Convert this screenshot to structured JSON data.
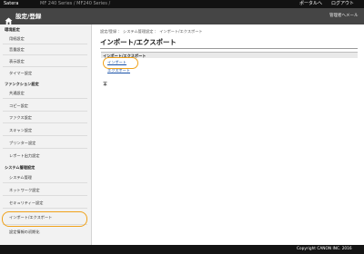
{
  "topbar": {
    "brand": "Satera",
    "device": "MF 240 Series / MF240 Series / ",
    "portal": "ポータルへ",
    "logout": "ログアウト"
  },
  "header": {
    "title": "設定/登録",
    "mail_admin": "管理者へメール"
  },
  "sidebar": {
    "sec_preferences": "環境設定",
    "items_preferences": [
      "用紙設定",
      "音量設定",
      "表示設定",
      "タイマー設定"
    ],
    "sec_function": "ファンクション設定",
    "items_function": [
      "共通設定",
      "コピー設定",
      "ファクス設定",
      "スキャン設定",
      "プリンター設定",
      "レポート出力設定"
    ],
    "sec_system": "システム管理設定",
    "items_system": [
      "システム管理",
      "ネットワーク設定",
      "セキュリティー設定",
      "インポート/エクスポート",
      "設定情報の初期化"
    ]
  },
  "main": {
    "breadcrumb": "設定/登録 ： システム管理設定 ： インポート/エクスポート",
    "title": "インポート/エクスポート",
    "panel_header": "インポート/エクスポート",
    "link_import": "インポート",
    "link_export": "エクスポート",
    "top_icon": "page-top-icon"
  },
  "footer": {
    "copyright": "Copyright CANON INC. 2016"
  },
  "colors": {
    "highlight": "#f0a21a",
    "link": "#1a52a8",
    "header_bg": "#454545"
  }
}
